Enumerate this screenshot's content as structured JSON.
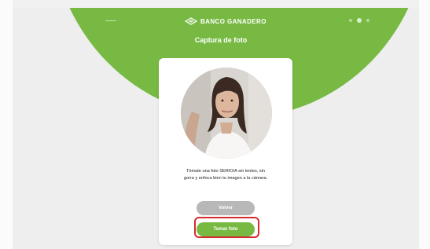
{
  "header": {
    "brand_name": "BANCO GANADERO",
    "brand_icon": "leaf-logo-icon"
  },
  "page_title": "Captura de foto",
  "card": {
    "photo_alt": "Selfie preview",
    "instructions_line1": "Tómate una foto SERIO/A sin lentes, sin",
    "instructions_line2": "gorra y enfoca bien tu imagen a la cámara."
  },
  "buttons": {
    "back_label": "Volver",
    "take_photo_label": "Tomar foto"
  },
  "colors": {
    "accent": "#78b943",
    "disabled": "#b8b8b8",
    "highlight": "#d62b2b"
  }
}
